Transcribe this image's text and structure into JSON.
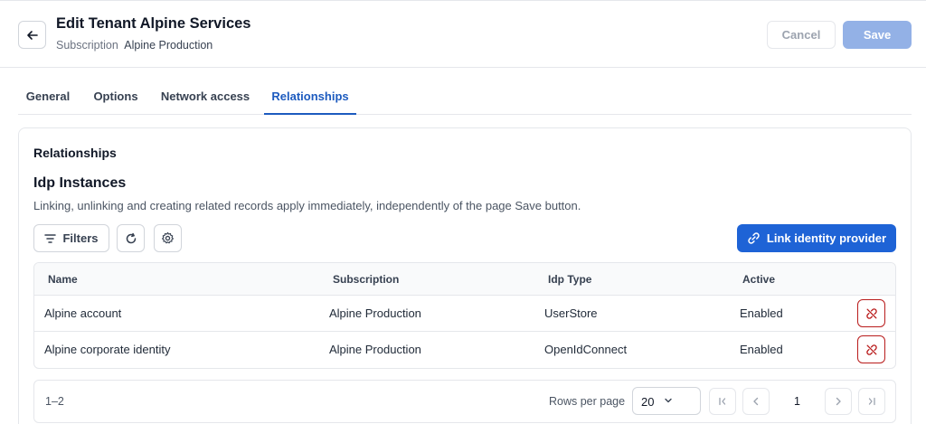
{
  "header": {
    "title": "Edit Tenant Alpine Services",
    "subscription_label": "Subscription",
    "subscription_value": "Alpine Production",
    "cancel_label": "Cancel",
    "save_label": "Save"
  },
  "tabs": [
    {
      "label": "General",
      "active": false
    },
    {
      "label": "Options",
      "active": false
    },
    {
      "label": "Network access",
      "active": false
    },
    {
      "label": "Relationships",
      "active": true
    }
  ],
  "card": {
    "title": "Relationships",
    "section_title": "Idp Instances",
    "section_description": "Linking, unlinking and creating related records apply immediately, independently of the page Save button.",
    "filters_label": "Filters",
    "link_button_label": "Link identity provider"
  },
  "table": {
    "columns": [
      "Name",
      "Subscription",
      "Idp Type",
      "Active"
    ],
    "rows": [
      {
        "name": "Alpine account",
        "subscription": "Alpine Production",
        "idp_type": "UserStore",
        "active": "Enabled"
      },
      {
        "name": "Alpine corporate identity",
        "subscription": "Alpine Production",
        "idp_type": "OpenIdConnect",
        "active": "Enabled"
      }
    ]
  },
  "pagination": {
    "range": "1–2",
    "rows_per_page_label": "Rows per page",
    "rows_per_page_value": "20",
    "current_page": "1"
  },
  "colors": {
    "accent": "#1e63d6",
    "save_disabled": "#93b1e6",
    "danger": "#b91c1c"
  },
  "icons": {
    "back": "arrow-left-icon",
    "filters": "filter-lines-icon",
    "refresh": "refresh-icon",
    "settings": "gear-icon",
    "link": "link-icon",
    "unlink": "unlink-icon",
    "first": "first-page-icon",
    "prev": "chevron-left-icon",
    "next": "chevron-right-icon",
    "last": "last-page-icon",
    "dropdown": "chevron-down-icon"
  }
}
